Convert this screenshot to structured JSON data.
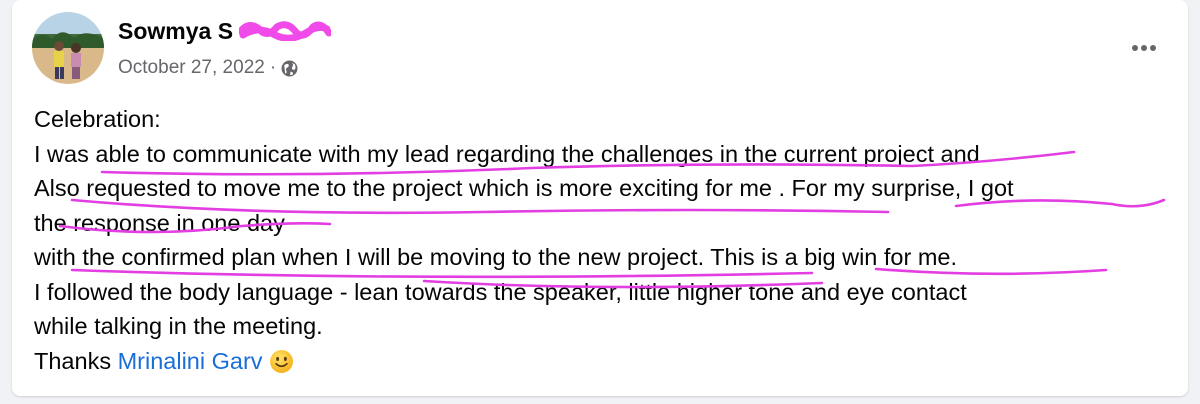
{
  "post": {
    "author_name": "Sowmya S",
    "date": "October 27, 2022",
    "separator": "·",
    "audience_icon": "globe-icon",
    "more_icon": "more-options-icon",
    "lines": [
      "Celebration:",
      "I was able to communicate with my lead regarding the challenges in the current project and",
      "Also requested to move me to the project which is more exciting for me . For my surprise, I got",
      "the response in one day",
      "with the confirmed plan when I will be moving to the new project. This is a big win for me.",
      "I followed the body language - lean towards the speaker, little higher tone and eye contact",
      "while talking in the meeting."
    ],
    "thanks_text": "Thanks ",
    "mention": "Mrinalini Garv",
    "emoji": "slightly-smiling-face"
  },
  "colors": {
    "mention": "#1a6ed8",
    "annotation": "#e23ee2",
    "secondary_text": "#65676b"
  }
}
